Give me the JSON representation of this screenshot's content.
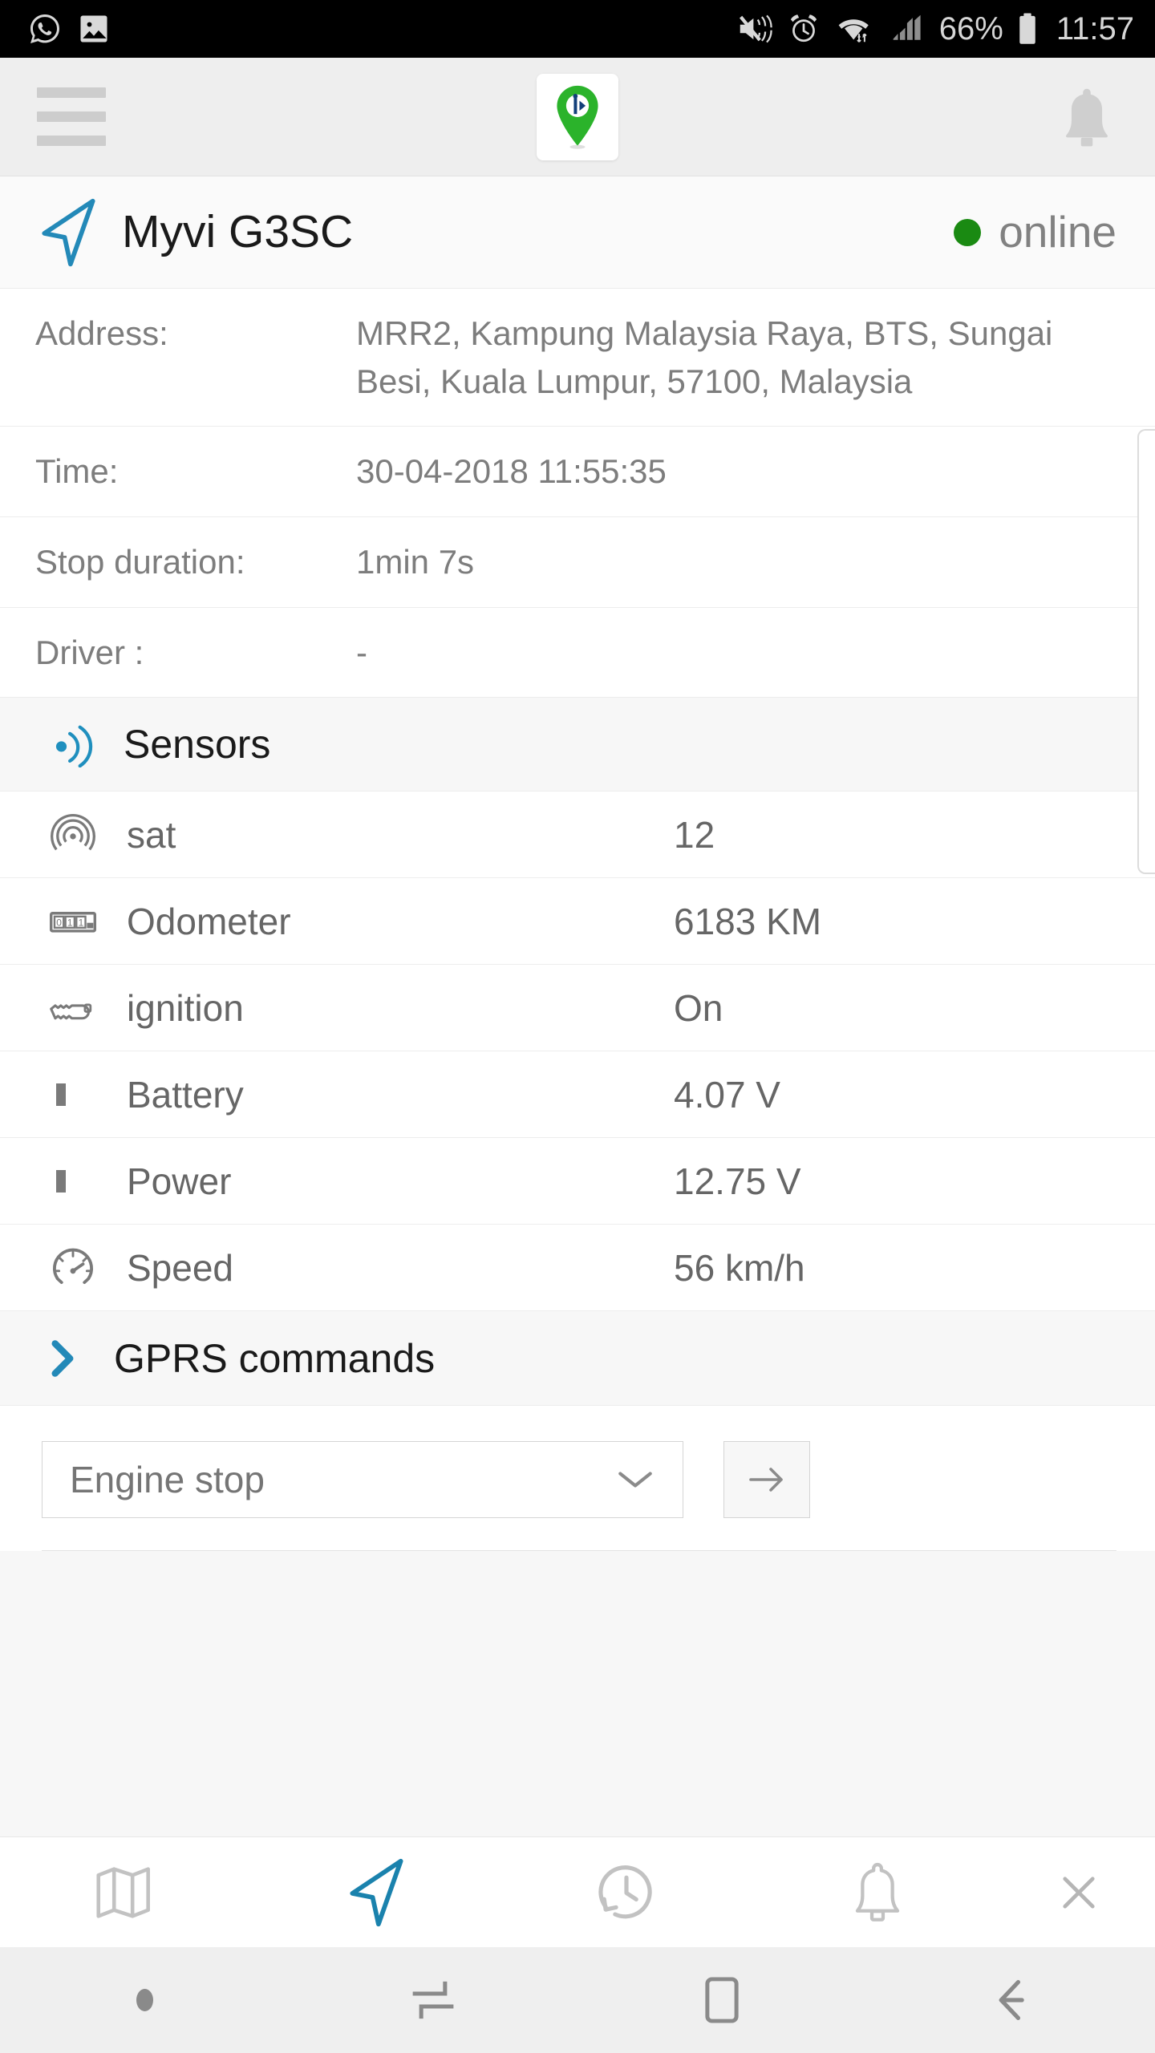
{
  "statusbar": {
    "left_icons": [
      "whatsapp-icon",
      "image-icon"
    ],
    "right_icons": [
      "mute-icon",
      "alarm-icon",
      "wifi-icon",
      "signal-icon",
      "battery-icon"
    ],
    "battery_percent": "66%",
    "time": "11:57"
  },
  "header": {
    "menu_icon": "hamburger-menu-icon",
    "logo_icon": "map-pin-logo-icon",
    "notifications_icon": "bell-icon"
  },
  "device": {
    "nav_icon": "navigation-arrow-icon",
    "name": "Myvi G3SC",
    "status_label": "online",
    "status_color": "#1a8a12"
  },
  "info": {
    "rows": [
      {
        "label": "Address:",
        "value": "MRR2, Kampung Malaysia Raya, BTS, Sungai Besi, Kuala Lumpur, 57100, Malaysia"
      },
      {
        "label": "Time:",
        "value": "30-04-2018 11:55:35"
      },
      {
        "label": "Stop duration:",
        "value": "1min 7s"
      },
      {
        "label": "Driver :",
        "value": "-"
      }
    ]
  },
  "sensors": {
    "section_icon": "broadcast-waves-icon",
    "title": "Sensors",
    "rows": [
      {
        "icon": "satellite-icon",
        "name": "sat",
        "value": "12"
      },
      {
        "icon": "odometer-icon",
        "name": "Odometer",
        "value": "6183 KM"
      },
      {
        "icon": "key-icon",
        "name": "ignition",
        "value": "On"
      },
      {
        "icon": "battery-bar-icon",
        "name": "Battery",
        "value": "4.07 V"
      },
      {
        "icon": "battery-bar-icon",
        "name": "Power",
        "value": "12.75 V"
      },
      {
        "icon": "speedometer-icon",
        "name": "Speed",
        "value": "56 km/h"
      }
    ]
  },
  "gprs": {
    "chevron_icon": "chevron-right-icon",
    "title": "GPRS commands",
    "selected_command": "Engine stop",
    "dropdown_icon": "chevron-down-icon",
    "send_icon": "arrow-right-icon"
  },
  "bottomnav": {
    "items": [
      {
        "icon": "map-icon",
        "active": false
      },
      {
        "icon": "navigation-arrow-icon",
        "active": true
      },
      {
        "icon": "history-clock-icon",
        "active": false
      },
      {
        "icon": "bell-icon",
        "active": false
      },
      {
        "icon": "close-icon",
        "active": false
      }
    ],
    "active_color": "#1a82ad",
    "inactive_color": "#c2c2c2"
  },
  "sysnav": {
    "items": [
      "dot-indicator",
      "recents-icon",
      "home-icon",
      "back-icon"
    ]
  }
}
